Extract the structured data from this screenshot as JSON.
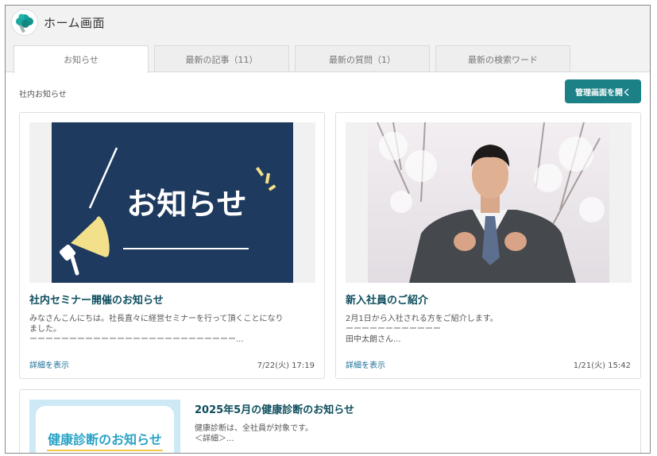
{
  "header": {
    "title": "ホーム画面"
  },
  "tabs": [
    {
      "label": "お知らせ",
      "active": true
    },
    {
      "label": "最新の記事（11）",
      "active": false
    },
    {
      "label": "最新の質問（1）",
      "active": false
    },
    {
      "label": "最新の検索ワード",
      "active": false
    }
  ],
  "section": {
    "label": "社内お知らせ",
    "admin_button": "管理画面を開く"
  },
  "cards": [
    {
      "image_text": "お知らせ",
      "title": "社内セミナー開催のお知らせ",
      "body_lines": [
        "みなさんこんにちは。社長直々に経営セミナーを行って頂くことになり",
        "ました。",
        "ーーーーーーーーーーーーーーーーーーーーーーーーーー..."
      ],
      "link": "詳細を表示",
      "date": "7/22(火) 17:19"
    },
    {
      "title": "新入社員のご紹介",
      "body_lines": [
        "2月1日から入社される方をご紹介します。",
        "ーーーーーーーーーーーー",
        "田中太朗さん..."
      ],
      "link": "詳細を表示",
      "date": "1/21(火) 15:42"
    },
    {
      "image_text": "健康診断のお知らせ",
      "title": "2025年5月の健康診断のお知らせ",
      "body_lines": [
        "健康診断は、全社員が対象です。",
        "＜詳細＞..."
      ]
    }
  ],
  "colors": {
    "accent": "#1b8187",
    "title_text": "#0f4e5e",
    "link": "#1b6f96",
    "notice_bg": "#1e3a5f",
    "megaphone": "#f2e08a",
    "health_text": "#2aa3c6"
  }
}
